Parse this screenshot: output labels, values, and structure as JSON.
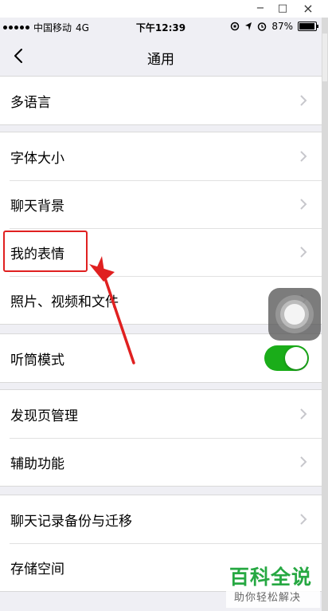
{
  "window": {
    "controls": {
      "minimize": "−",
      "maximize": "□",
      "close": "×"
    }
  },
  "status_bar": {
    "carrier": "中国移动",
    "network": "4G",
    "time": "下午12:39",
    "battery_percent": "87%",
    "battery_level": 0.87
  },
  "nav": {
    "title": "通用",
    "back_icon": "chevron-left-icon"
  },
  "groups": [
    {
      "items": [
        {
          "label": "多语言"
        }
      ]
    },
    {
      "items": [
        {
          "label": "字体大小"
        },
        {
          "label": "聊天背景"
        },
        {
          "label": "我的表情"
        },
        {
          "label": "照片、视频和文件"
        }
      ]
    },
    {
      "items": [
        {
          "label": "听筒模式",
          "toggle": true,
          "toggle_on": true
        }
      ]
    },
    {
      "items": [
        {
          "label": "发现页管理"
        },
        {
          "label": "辅助功能"
        }
      ]
    },
    {
      "items": [
        {
          "label": "聊天记录备份与迁移"
        },
        {
          "label": "存储空间"
        }
      ]
    }
  ],
  "colors": {
    "toggle_on": "#1aad19",
    "highlight": "#e02020",
    "watermark": "#26a842"
  },
  "watermark": {
    "title": "百科全说",
    "subtitle": "助你轻松解决"
  }
}
